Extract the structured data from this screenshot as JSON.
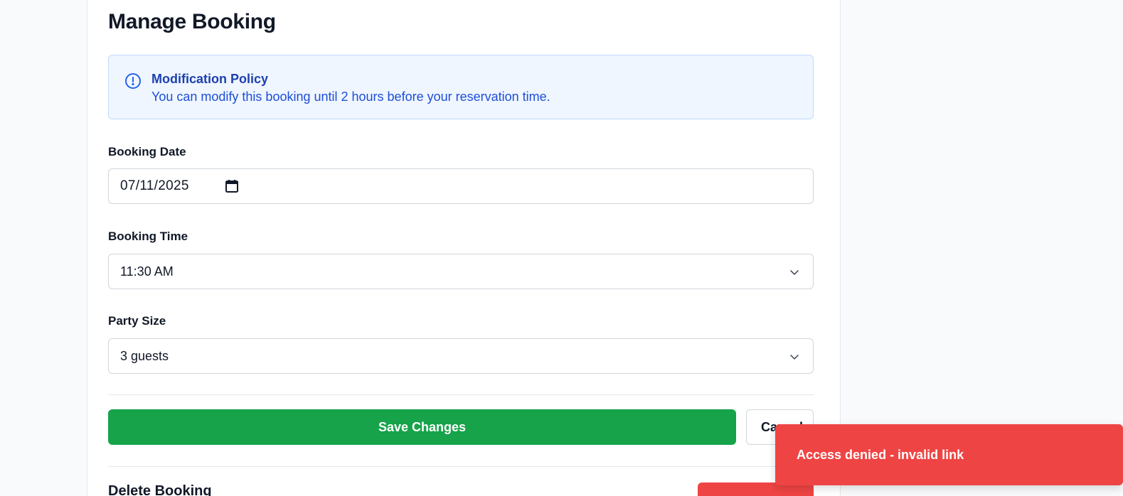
{
  "page": {
    "title": "Manage Booking"
  },
  "policy": {
    "title": "Modification Policy",
    "text": "You can modify this booking until 2 hours before your reservation time.",
    "icon": "info-circle-icon"
  },
  "form": {
    "date": {
      "label": "Booking Date",
      "value": "07/11/2025",
      "icon": "calendar-icon"
    },
    "time": {
      "label": "Booking Time",
      "value": "11:30 AM",
      "icon": "chevron-down-icon"
    },
    "party": {
      "label": "Party Size",
      "value": "3 guests",
      "icon": "chevron-down-icon"
    }
  },
  "actions": {
    "save_label": "Save Changes",
    "cancel_label": "Cancel"
  },
  "delete": {
    "heading": "Delete Booking"
  },
  "toast": {
    "message": "Access denied - invalid link"
  },
  "colors": {
    "primary_green": "#16a34a",
    "danger_red": "#ef4444",
    "info_bg": "#eff6ff",
    "info_border": "#bfdbfe",
    "info_title": "#1e40af",
    "info_text": "#1d4ed8"
  }
}
